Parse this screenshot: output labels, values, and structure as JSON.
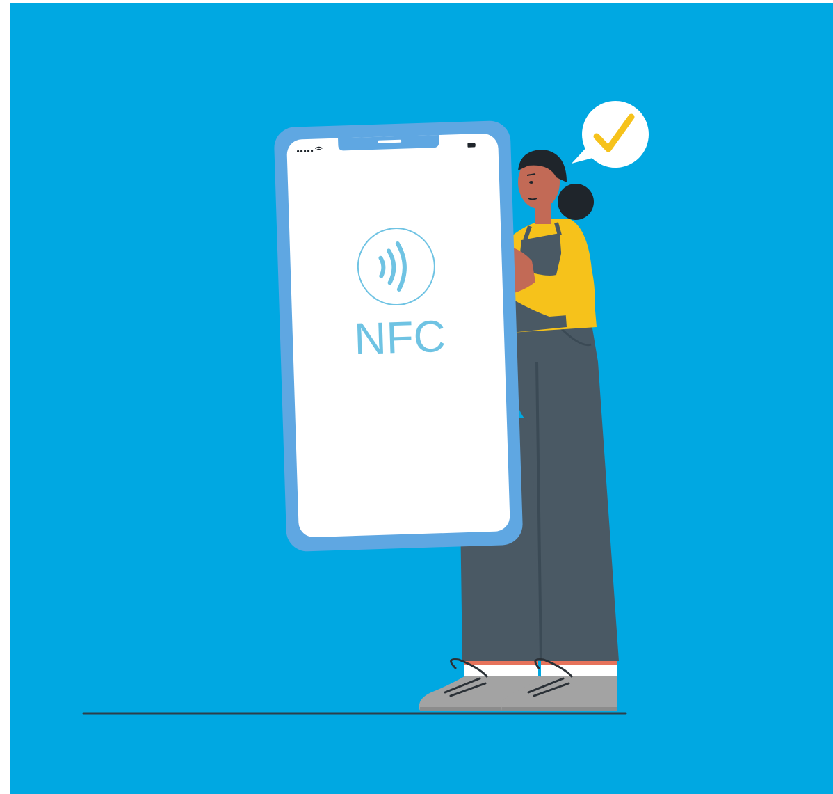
{
  "scene": {
    "description_free": true,
    "colors": {
      "background": "#00a8e2",
      "border": "#ffffff",
      "phone_frame": "#5fa7e2",
      "phone_screen": "#ffffff",
      "nfc_accent": "#6fc3e3",
      "bubble": "#ffffff",
      "check": "#f6c21b",
      "skin": "#c26a56",
      "hair": "#1f252b",
      "shirt": "#f6c21b",
      "overalls": "#4a5964",
      "overalls_dark": "#3b4a55",
      "sock": "#ffffff",
      "sock_stripe": "#e6735b",
      "shoe": "#a3a3a3",
      "shoe_dark": "#8c8c8c",
      "laces": "#2b3137",
      "ground_line": "#2d3f4a"
    },
    "icons": {
      "status_signal": "signal-dots-icon",
      "status_wifi": "wifi-icon",
      "status_battery": "battery-icon",
      "nfc": "nfc-waves-icon",
      "check": "checkmark-icon"
    }
  },
  "phone": {
    "nfc_label": "NFC"
  }
}
